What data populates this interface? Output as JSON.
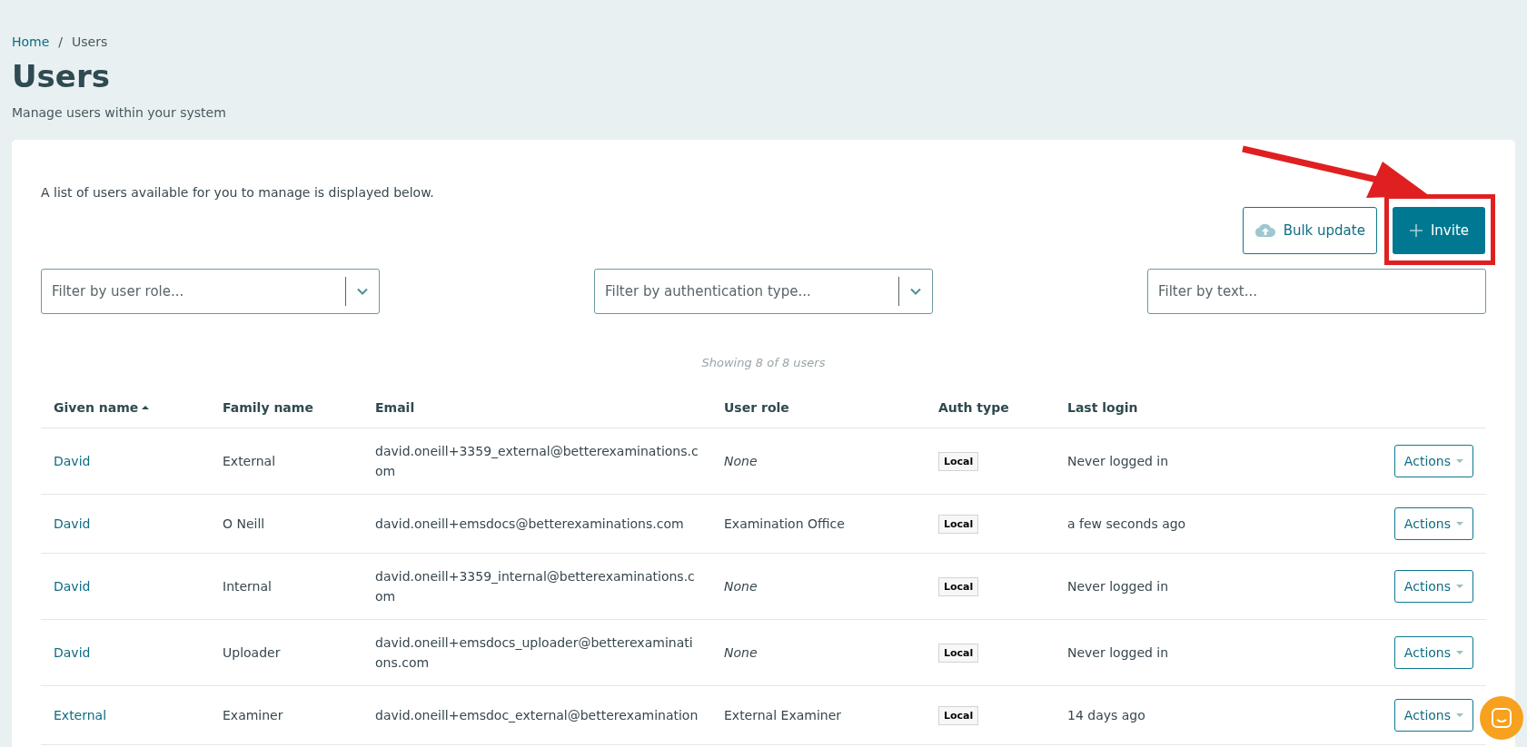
{
  "breadcrumb": [
    {
      "label": "Home",
      "kind": "link"
    },
    {
      "label": "Users",
      "kind": "current"
    }
  ],
  "breadcrumb_separator": "/",
  "title": "Users",
  "subtitle": "Manage users within your system",
  "card": {
    "intro": "A list of users available for you to manage is displayed below.",
    "buttons": [
      {
        "label": "Bulk update",
        "kind": "outline"
      },
      {
        "label": "Invite",
        "kind": "primary"
      }
    ],
    "filters": [
      {
        "placeholder": "Filter by user role...",
        "kind": "select"
      },
      {
        "placeholder": "Filter by authentication type...",
        "kind": "select"
      },
      {
        "placeholder": "Filter by text...",
        "kind": "text"
      }
    ],
    "summary": "Showing 8 of 8 users"
  },
  "table": {
    "columns": [
      {
        "label": "Given name",
        "sorted": true
      },
      {
        "label": "Family name",
        "sorted": false
      },
      {
        "label": "Email",
        "sorted": false
      },
      {
        "label": "User role",
        "sorted": false
      },
      {
        "label": "Auth type",
        "sorted": false
      },
      {
        "label": "Last login",
        "sorted": false
      }
    ],
    "rows": [
      {
        "given_name": "David",
        "family_name": "External",
        "email": "david.oneill+3359_external@betterexaminations.com",
        "user_role": "None",
        "role_assigned": false,
        "auth_type": "Local",
        "last_login": "Never logged in",
        "action": "Actions"
      },
      {
        "given_name": "David",
        "family_name": "O Neill",
        "email": "david.oneill+emsdocs@betterexaminations.com",
        "user_role": "Examination Office",
        "role_assigned": true,
        "auth_type": "Local",
        "last_login": "a few seconds ago",
        "action": "Actions"
      },
      {
        "given_name": "David",
        "family_name": "Internal",
        "email": "david.oneill+3359_internal@betterexaminations.com",
        "user_role": "None",
        "role_assigned": false,
        "auth_type": "Local",
        "last_login": "Never logged in",
        "action": "Actions"
      },
      {
        "given_name": "David",
        "family_name": "Uploader",
        "email": "david.oneill+emsdocs_uploader@betterexaminations.com",
        "user_role": "None",
        "role_assigned": false,
        "auth_type": "Local",
        "last_login": "Never logged in",
        "action": "Actions"
      },
      {
        "given_name": "External",
        "family_name": "Examiner",
        "email": "david.oneill+emsdoc_external@betterexamination",
        "user_role": "External Examiner",
        "role_assigned": true,
        "auth_type": "Local",
        "last_login": "14 days ago",
        "action": "Actions"
      }
    ]
  }
}
